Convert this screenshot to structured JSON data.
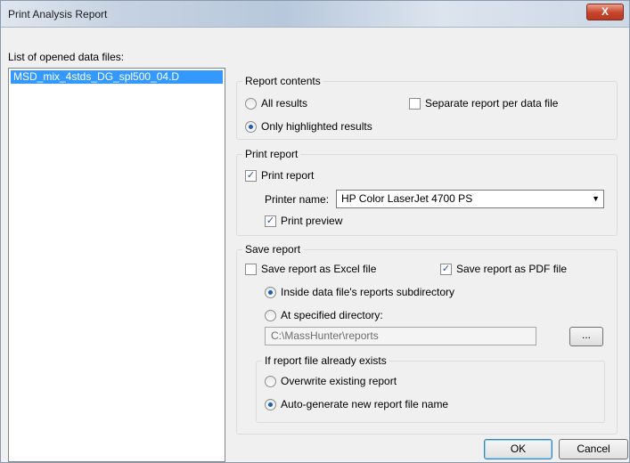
{
  "window": {
    "title": "Print Analysis Report",
    "close_glyph": "X"
  },
  "files": {
    "label": "List of opened data files:",
    "items": [
      "MSD_mix_4stds_DG_spl500_04.D"
    ]
  },
  "report_contents": {
    "title": "Report contents",
    "all_results": "All results",
    "only_highlighted": "Only highlighted results",
    "separate_per_file": "Separate report per data file",
    "selected": "only_highlighted",
    "separate_checked": false
  },
  "print_report": {
    "title": "Print report",
    "print_report_label": "Print report",
    "print_report_checked": true,
    "printer_name_label": "Printer name:",
    "printer_name_value": "HP Color LaserJet 4700 PS",
    "print_preview_label": "Print preview",
    "print_preview_checked": true
  },
  "save_report": {
    "title": "Save report",
    "excel_label": "Save report as Excel file",
    "excel_checked": false,
    "pdf_label": "Save report as PDF file",
    "pdf_checked": true,
    "inside_subdir_label": "Inside data file's reports subdirectory",
    "specified_dir_label": "At specified directory:",
    "location_selected": "inside_subdir",
    "directory_value": "C:\\MassHunter\\reports",
    "browse_label": "...",
    "exists_group_title": "If report file already exists",
    "overwrite_label": "Overwrite existing report",
    "autogenerate_label": "Auto-generate new report file name",
    "exists_selected": "autogenerate"
  },
  "buttons": {
    "ok": "OK",
    "cancel": "Cancel"
  },
  "colors": {
    "selection": "#3399ff",
    "close_button": "#c7432b"
  }
}
